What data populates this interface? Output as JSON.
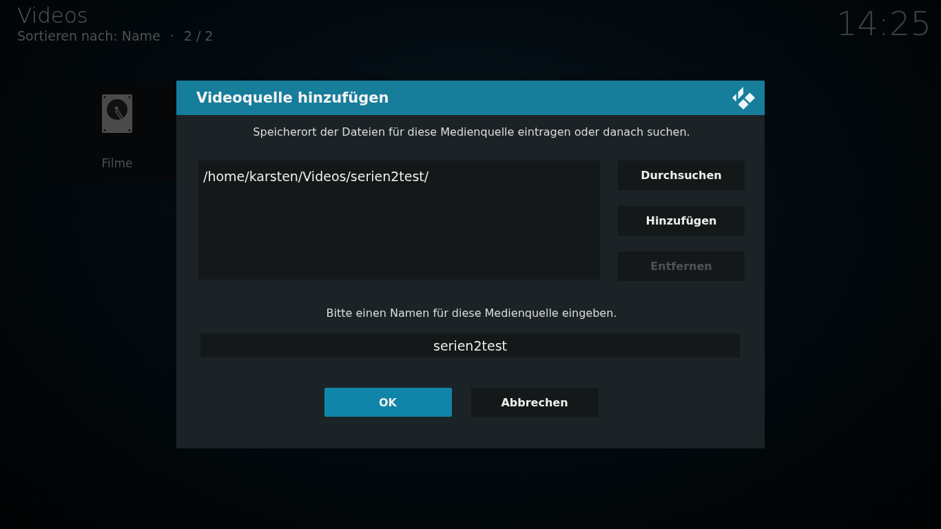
{
  "header": {
    "title": "Videos",
    "subtitle": "Sortieren nach: Name",
    "separator": "·",
    "count": "2 / 2",
    "clock": "14:25"
  },
  "sources": [
    {
      "label": "Filme"
    }
  ],
  "dialog": {
    "title": "Videoquelle hinzufügen",
    "instruction": "Speicherort der Dateien für diese Medienquelle eintragen oder danach suchen.",
    "paths": [
      "/home/karsten/Videos/serien2test/"
    ],
    "side_buttons": [
      {
        "label": "Durchsuchen",
        "disabled": false
      },
      {
        "label": "Hinzufügen",
        "disabled": false
      },
      {
        "label": "Entfernen",
        "disabled": true
      }
    ],
    "name_prompt": "Bitte einen Namen für diese Medienquelle eingeben.",
    "name_value": "serien2test",
    "buttons": [
      {
        "label": "OK",
        "selected": true
      },
      {
        "label": "Abbrechen",
        "selected": false
      }
    ]
  }
}
